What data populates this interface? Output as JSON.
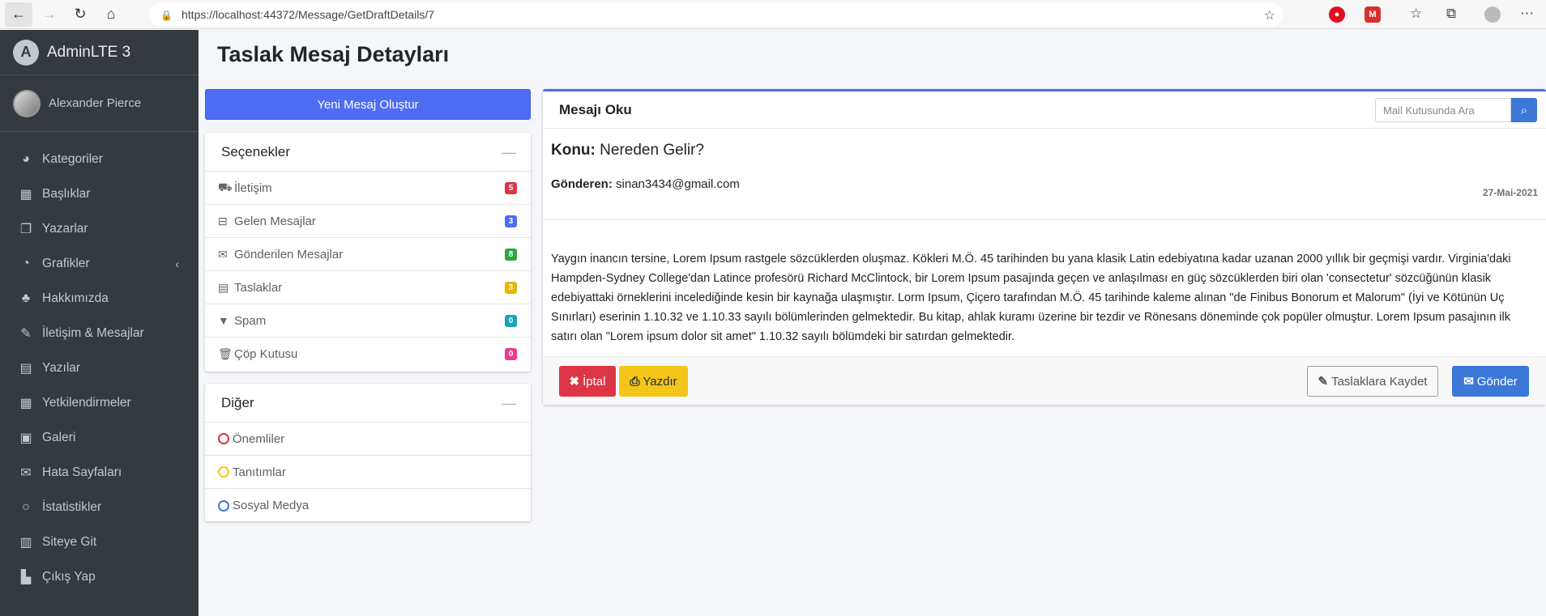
{
  "browser": {
    "url": "https://localhost:44372/Message/GetDraftDetails/7"
  },
  "brand": {
    "name": "AdminLTE 3",
    "logo_letter": "A"
  },
  "user": {
    "name": "Alexander Pierce"
  },
  "sidebar": {
    "items": [
      {
        "label": "Kategoriler",
        "icon": "dashboard-icon",
        "glyph": "◕"
      },
      {
        "label": "Başlıklar",
        "icon": "grid-icon",
        "glyph": "▦"
      },
      {
        "label": "Yazarlar",
        "icon": "copy-icon",
        "glyph": "❐"
      },
      {
        "label": "Grafikler",
        "icon": "pie-chart-icon",
        "glyph": "◔"
      },
      {
        "label": "Hakkımızda",
        "icon": "tree-icon",
        "glyph": "♣"
      },
      {
        "label": "İletişim & Mesajlar",
        "icon": "edit-icon",
        "glyph": "✎"
      },
      {
        "label": "Yazılar",
        "icon": "table-icon",
        "glyph": "▤"
      },
      {
        "label": "Yetkilendirmeler",
        "icon": "calendar-icon",
        "glyph": "▦"
      },
      {
        "label": "Galeri",
        "icon": "image-icon",
        "glyph": "▣"
      },
      {
        "label": "Hata Sayfaları",
        "icon": "envelope-icon",
        "glyph": "✉"
      },
      {
        "label": "İstatistikler",
        "icon": "circle-icon",
        "glyph": "○"
      },
      {
        "label": "Siteye Git",
        "icon": "book-icon",
        "glyph": "▥"
      },
      {
        "label": "Çıkış Yap",
        "icon": "door-icon",
        "glyph": "▙"
      }
    ]
  },
  "page": {
    "title": "Taslak Mesaj Detayları"
  },
  "compose_button": "Yeni Mesaj Oluştur",
  "options_card": {
    "title": "Seçenekler",
    "folders": [
      {
        "label": "İletişim",
        "icon": "truck-icon",
        "glyph": "⛟",
        "count": "5",
        "color": "#dc3545"
      },
      {
        "label": "Gelen Mesajlar",
        "icon": "inbox-icon",
        "glyph": "⊟",
        "count": "3",
        "color": "#4f6cf5"
      },
      {
        "label": "Gönderilen Mesajlar",
        "icon": "envelope-icon",
        "glyph": "✉",
        "count": "8",
        "color": "#28a745"
      },
      {
        "label": "Taslaklar",
        "icon": "file-icon",
        "glyph": "▤",
        "count": "3",
        "color": "#e8b50c"
      },
      {
        "label": "Spam",
        "icon": "filter-icon",
        "glyph": "▼",
        "count": "0",
        "color": "#17a2b8"
      },
      {
        "label": "Çöp Kutusu",
        "icon": "trash-icon",
        "glyph": "🗑",
        "count": "0",
        "color": "#e83e8c"
      }
    ]
  },
  "other_card": {
    "title": "Diğer",
    "labels": [
      {
        "label": "Önemliler",
        "color": "#dc3545"
      },
      {
        "label": "Tanıtımlar",
        "color": "#f5c51a"
      },
      {
        "label": "Sosyal Medya",
        "color": "#3c78d8"
      }
    ]
  },
  "mail": {
    "title": "Mesajı Oku",
    "search_placeholder": "Mail Kutusunda Ara",
    "subject_label": "Konu:",
    "subject": "Nereden Gelir?",
    "sender_label": "Gönderen:",
    "sender": "sinan3434@gmail.com",
    "date": "27-Mai-2021",
    "body": "Yaygın inancın tersine, Lorem Ipsum rastgele sözcüklerden oluşmaz. Kökleri M.Ö. 45 tarihinden bu yana klasik Latin edebiyatına kadar uzanan 2000 yıllık bir geçmişi vardır. Virginia'daki Hampden-Sydney College'dan Latince profesörü Richard McClintock, bir Lorem Ipsum pasajında geçen ve anlaşılması en güç sözcüklerden biri olan 'consectetur' sözcüğünün klasik edebiyattaki örneklerini incelediğinde kesin bir kaynağa ulaşmıştır. Lorm Ipsum, Çiçero tarafından M.Ö. 45 tarihinde kaleme alınan \"de Finibus Bonorum et Malorum\" (İyi ve Kötünün Uç Sınırları) eserinin 1.10.32 ve 1.10.33 sayılı bölümlerinden gelmektedir. Bu kitap, ahlak kuramı üzerine bir tezdir ve Rönesans döneminde çok popüler olmuştur. Lorem Ipsum pasajının ilk satırı olan \"Lorem ipsum dolor sit amet\" 1.10.32 sayılı bölümdeki bir satırdan gelmektedir.",
    "buttons": {
      "cancel": "İptal",
      "print": "Yazdır",
      "save_draft": "Taslaklara Kaydet",
      "send": "Gönder"
    }
  }
}
